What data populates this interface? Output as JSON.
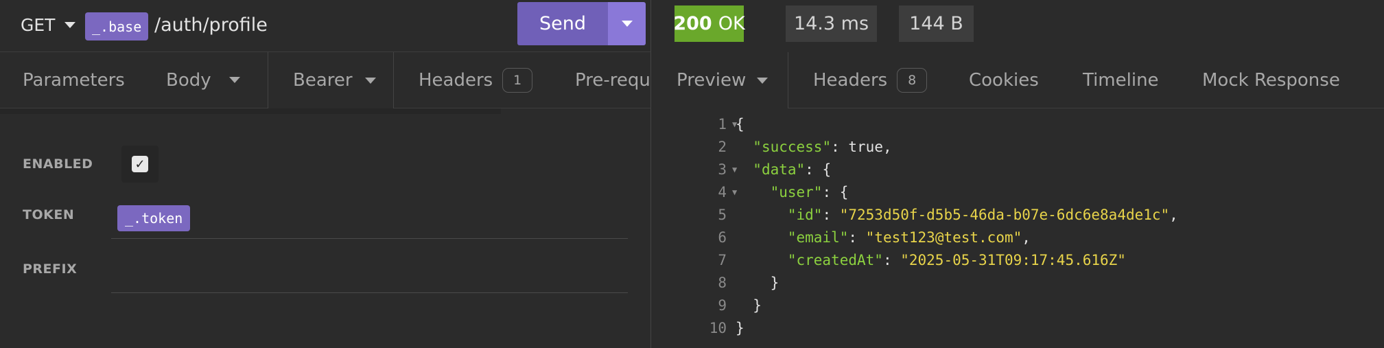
{
  "request": {
    "method": "GET",
    "base_var": "_.base",
    "path": "/auth/profile",
    "send_label": "Send"
  },
  "request_tabs": [
    {
      "label": "Parameters"
    },
    {
      "label": "Body"
    },
    {
      "label": "Bearer"
    },
    {
      "label": "Headers",
      "badge": "1"
    },
    {
      "label": "Pre-requ"
    }
  ],
  "auth_form": {
    "enabled_label": "ENABLED",
    "enabled": true,
    "token_label": "TOKEN",
    "token_var": "_.token",
    "prefix_label": "PREFIX"
  },
  "response": {
    "status_code": "200",
    "status_text": "OK",
    "time": "14.3 ms",
    "size": "144 B"
  },
  "response_tabs": [
    {
      "label": "Preview"
    },
    {
      "label": "Headers",
      "badge": "8"
    },
    {
      "label": "Cookies"
    },
    {
      "label": "Timeline"
    },
    {
      "label": "Mock Response"
    }
  ],
  "code_lines": [
    {
      "n": "1",
      "fold": true
    },
    {
      "n": "2"
    },
    {
      "n": "3",
      "fold": true
    },
    {
      "n": "4",
      "fold": true
    },
    {
      "n": "5"
    },
    {
      "n": "6"
    },
    {
      "n": "7"
    },
    {
      "n": "8"
    },
    {
      "n": "9"
    },
    {
      "n": "10"
    }
  ],
  "json_body": {
    "k_success": "\"success\"",
    "v_success": "true",
    "k_data": "\"data\"",
    "k_user": "\"user\"",
    "k_id": "\"id\"",
    "v_id": "\"7253d50f-d5b5-46da-b07e-6dc6e8a4de1c\"",
    "k_email": "\"email\"",
    "v_email": "\"test123@test.com\"",
    "k_createdAt": "\"createdAt\"",
    "v_createdAt": "\"2025-05-31T09:17:45.616Z\""
  },
  "colors": {
    "accent": "#7060b8",
    "variable_chip": "#7b68c0",
    "status_ok": "#6aa82b",
    "json_key": "#8cd13f",
    "json_string": "#e8d44a"
  }
}
